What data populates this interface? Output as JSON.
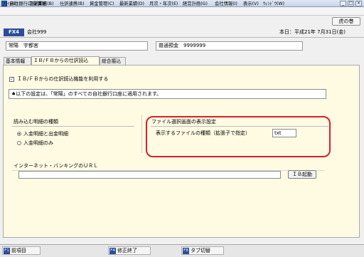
{
  "window": {
    "title": "自社銀行口座情報"
  },
  "menu": [
    "ﾌｧｲﾙ(E)",
    "日常業務(B)",
    "仕訳連携(B)",
    "資金管理(C)",
    "最新業績(D)",
    "月次・年次(E)",
    "経営計画(G)",
    "会社情報(I)",
    "表示(V)",
    "ｳｨﾝﾄﾞｳ(W)"
  ],
  "help_button": "虎の巻",
  "header": {
    "code": "FX4",
    "company": "会社999",
    "date": "本日：平成21年 7月31日(金)"
  },
  "account": {
    "bank": "常陽　宇都宮",
    "account": "普通預金　9999999"
  },
  "tabs": [
    "基本情報",
    "ＩＢ/ＦＢからの仕訳読込",
    "総合振込"
  ],
  "content": {
    "use_ib_label": "ＩＢ/ＦＢからの仕訳読込機能を利用する",
    "use_ib_checked": "✓",
    "notice": "♠以下の設定は、「常陽」のすべての自社銀行口座に適用されます。",
    "detail_heading": "読み込む明細の種類",
    "radio_options": [
      "入金明細と出金明細",
      "入金明細のみ"
    ],
    "file_heading": "ファイル選択画面の表示設定",
    "file_label": "表示するファイルの種類（拡張子で指定）",
    "file_ext": "txt",
    "url_heading": "インターネット・バンキングのＵＲＬ",
    "url_value": "",
    "ib_button": "ＩＢ起動"
  },
  "footer": {
    "buttons": [
      {
        "key": "F1",
        "label": "前項目"
      },
      {
        "key": "F4",
        "label": "修正終了"
      },
      {
        "key": "F8",
        "label": "タブ切替"
      }
    ]
  },
  "colors": {
    "accent": "#2a4c9c",
    "panel_bg": "#fffbe3",
    "highlight": "#d4202b"
  }
}
